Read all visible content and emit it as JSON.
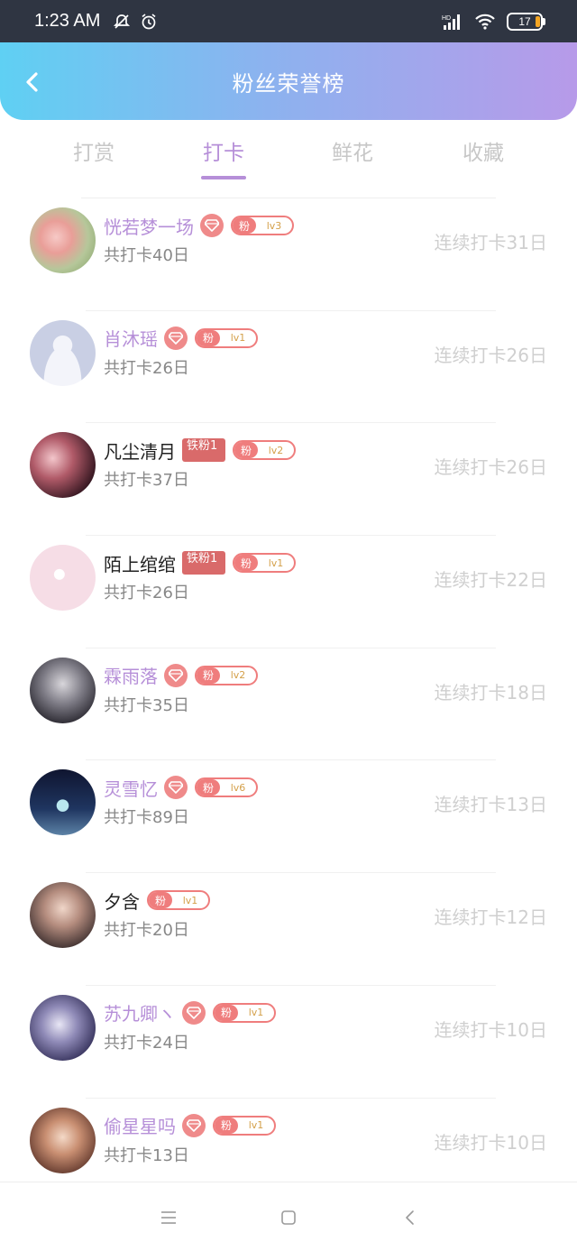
{
  "status_bar": {
    "time": "1:23 AM",
    "battery": "17",
    "net_label": "HD"
  },
  "header": {
    "title": "粉丝荣誉榜"
  },
  "tabs": [
    {
      "label": "打赏",
      "active": false
    },
    {
      "label": "打卡",
      "active": true
    },
    {
      "label": "鲜花",
      "active": false
    },
    {
      "label": "收藏",
      "active": false
    }
  ],
  "badges": {
    "fan_label": "粉",
    "iron_fan_label": "铁粉1"
  },
  "rows": [
    {
      "name": "恍若梦一场",
      "vip": true,
      "tiefen": false,
      "level": "lv3",
      "total": "共打卡40日",
      "streak": "连续打卡31日"
    },
    {
      "name": "肖沐瑶",
      "vip": true,
      "tiefen": false,
      "level": "lv1",
      "total": "共打卡26日",
      "streak": "连续打卡26日"
    },
    {
      "name": "凡尘清月",
      "vip": false,
      "tiefen": true,
      "level": "lv2",
      "total": "共打卡37日",
      "streak": "连续打卡26日"
    },
    {
      "name": "陌上绾绾",
      "vip": false,
      "tiefen": true,
      "level": "lv1",
      "total": "共打卡26日",
      "streak": "连续打卡22日"
    },
    {
      "name": "霖雨落",
      "vip": true,
      "tiefen": false,
      "level": "lv2",
      "total": "共打卡35日",
      "streak": "连续打卡18日"
    },
    {
      "name": "灵雪忆",
      "vip": true,
      "tiefen": false,
      "level": "lv6",
      "total": "共打卡89日",
      "streak": "连续打卡13日"
    },
    {
      "name": "夕含",
      "vip": false,
      "tiefen": false,
      "level": "lv1",
      "total": "共打卡20日",
      "streak": "连续打卡12日"
    },
    {
      "name": "苏九卿ヽ",
      "vip": true,
      "tiefen": false,
      "level": "lv1",
      "total": "共打卡24日",
      "streak": "连续打卡10日"
    },
    {
      "name": "偷星星吗",
      "vip": true,
      "tiefen": false,
      "level": "lv1",
      "total": "共打卡13日",
      "streak": "连续打卡10日"
    }
  ],
  "colors": {
    "accent": "#b68fd8",
    "badge": "#ef7d7d",
    "header_start": "#5fd0f3",
    "header_end": "#b79ae9"
  }
}
